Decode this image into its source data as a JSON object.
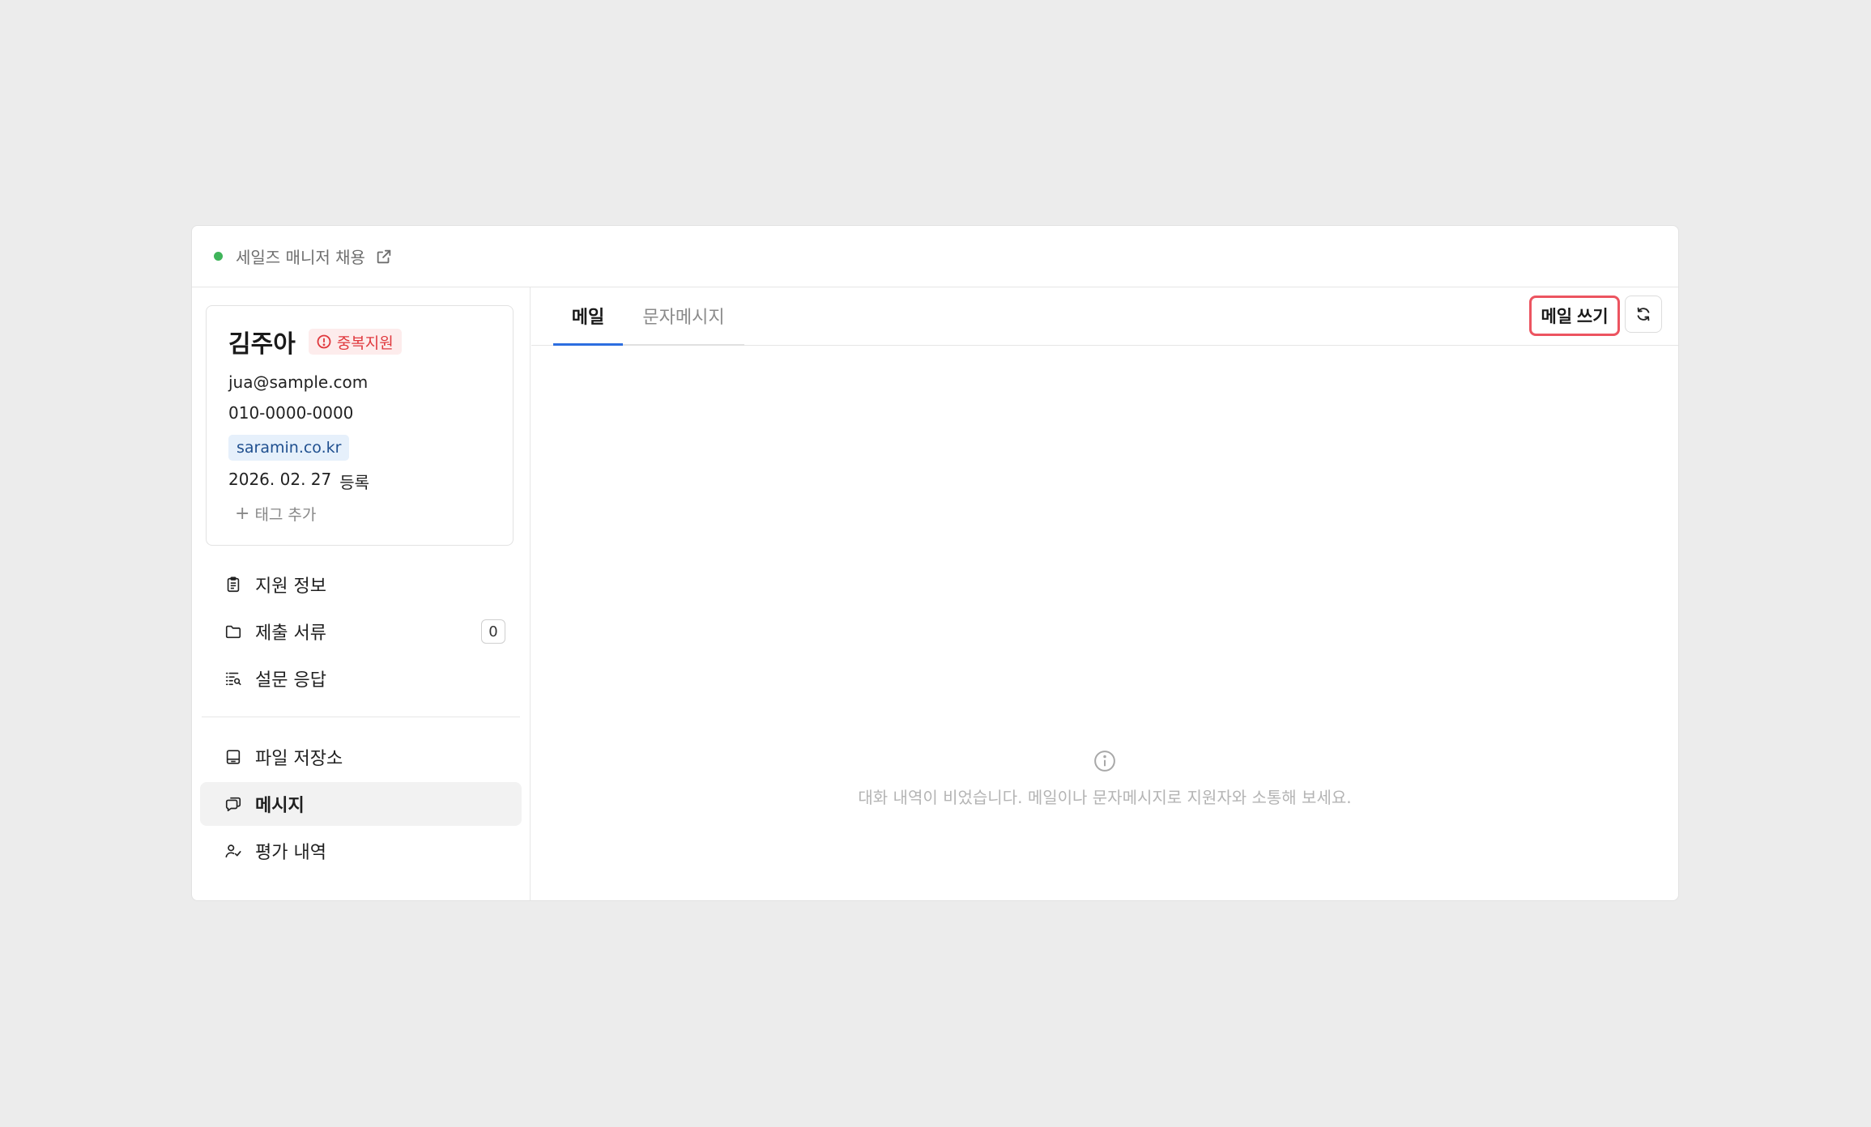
{
  "colors": {
    "status_dot": "#3fb45a",
    "accent_tab": "#2c6ee0",
    "highlight": "#ec5460",
    "badge_text": "#e0393e"
  },
  "header": {
    "job_title": "세일즈 매니저 채용",
    "link_icon": "external-link-icon"
  },
  "candidate": {
    "name": "김주아",
    "badge": "중복지원",
    "email": "jua@sample.com",
    "phone": "010-0000-0000",
    "source_tag": "saramin.co.kr",
    "registered_date": "2026. 02. 27",
    "registered_label": "등록",
    "add_tag_label": "태그 추가"
  },
  "sidebar": {
    "items": [
      {
        "label": "지원 정보",
        "icon": "clipboard-icon"
      },
      {
        "label": "제출 서류",
        "icon": "folder-icon",
        "count": "0"
      },
      {
        "label": "설문 응답",
        "icon": "list-search-icon"
      },
      {
        "label": "파일 저장소",
        "icon": "storage-icon"
      },
      {
        "label": "메시지",
        "icon": "chat-icon",
        "active": true
      },
      {
        "label": "평가 내역",
        "icon": "user-check-icon"
      }
    ]
  },
  "content": {
    "tabs": [
      {
        "label": "메일",
        "active": true
      },
      {
        "label": "문자메시지",
        "active": false
      }
    ],
    "compose_label": "메일 쓰기",
    "refresh_icon": "refresh-icon",
    "empty_message": "대화 내역이 비었습니다. 메일이나 문자메시지로 지원자와 소통해 보세요."
  }
}
